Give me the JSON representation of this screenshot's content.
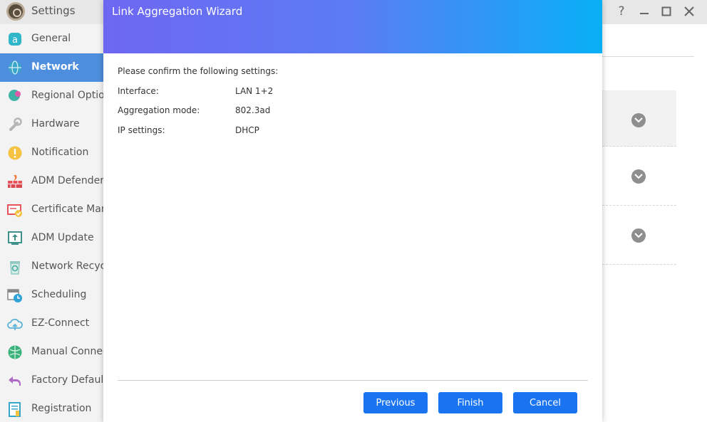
{
  "window": {
    "title": "Settings",
    "controls": [
      "help-icon",
      "minimize-icon",
      "maximize-icon",
      "close-icon"
    ]
  },
  "sidebar": {
    "items": [
      {
        "label": "General",
        "icon": "general-icon",
        "active": false
      },
      {
        "label": "Network",
        "icon": "globe-icon",
        "active": true
      },
      {
        "label": "Regional Options",
        "icon": "regional-globe-icon",
        "active": false
      },
      {
        "label": "Hardware",
        "icon": "wrench-icon",
        "active": false
      },
      {
        "label": "Notification",
        "icon": "alert-icon",
        "active": false
      },
      {
        "label": "ADM Defender",
        "icon": "firewall-icon",
        "active": false
      },
      {
        "label": "Certificate Manager",
        "icon": "certificate-icon",
        "active": false
      },
      {
        "label": "ADM Update",
        "icon": "update-icon",
        "active": false
      },
      {
        "label": "Network Recycle Bin",
        "icon": "recycle-bin-icon",
        "active": false
      },
      {
        "label": "Scheduling",
        "icon": "calendar-clock-icon",
        "active": false
      },
      {
        "label": "EZ-Connect",
        "icon": "cloud-upload-icon",
        "active": false
      },
      {
        "label": "Manual Connect",
        "icon": "network-ball-icon",
        "active": false
      },
      {
        "label": "Factory Default",
        "icon": "undo-arrow-icon",
        "active": false
      },
      {
        "label": "Registration",
        "icon": "registration-icon",
        "active": false
      }
    ]
  },
  "dialog": {
    "title": "Link Aggregation Wizard",
    "prompt": "Please confirm the following settings:",
    "settings": [
      {
        "label": "Interface:",
        "value": "LAN 1+2"
      },
      {
        "label": "Aggregation mode:",
        "value": "802.3ad"
      },
      {
        "label": "IP settings:",
        "value": "DHCP"
      }
    ],
    "buttons": {
      "previous": "Previous",
      "finish": "Finish",
      "cancel": "Cancel"
    }
  },
  "colors": {
    "sidebar_active": "#4d8fde",
    "header_gradient_start": "#6e67f2",
    "header_gradient_end": "#08b0f6",
    "button_blue": "#1a74f2"
  }
}
